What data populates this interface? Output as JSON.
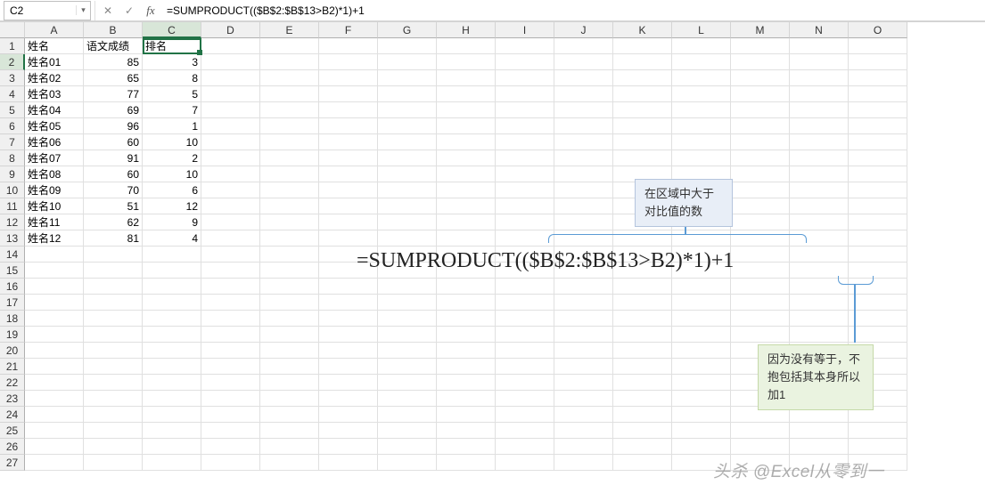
{
  "nameBox": {
    "value": "C2"
  },
  "formulaBar": {
    "formula": "=SUMPRODUCT(($B$2:$B$13>B2)*1)+1"
  },
  "icons": {
    "cancel": "✕",
    "confirm": "✓",
    "fx": "fx",
    "dropdown": "▾"
  },
  "columns": [
    "A",
    "B",
    "C",
    "D",
    "E",
    "F",
    "G",
    "H",
    "I",
    "J",
    "K",
    "L",
    "M",
    "N",
    "O"
  ],
  "rowCount": 27,
  "activeCol": 2,
  "activeRow": 1,
  "headers": {
    "A": "姓名",
    "B": "语文成绩",
    "C": "排名"
  },
  "rows": [
    {
      "name": "姓名01",
      "score": 85,
      "rank": 3
    },
    {
      "name": "姓名02",
      "score": 65,
      "rank": 8
    },
    {
      "name": "姓名03",
      "score": 77,
      "rank": 5
    },
    {
      "name": "姓名04",
      "score": 69,
      "rank": 7
    },
    {
      "name": "姓名05",
      "score": 96,
      "rank": 1
    },
    {
      "name": "姓名06",
      "score": 60,
      "rank": 10
    },
    {
      "name": "姓名07",
      "score": 91,
      "rank": 2
    },
    {
      "name": "姓名08",
      "score": 60,
      "rank": 10
    },
    {
      "name": "姓名09",
      "score": 70,
      "rank": 6
    },
    {
      "name": "姓名10",
      "score": 51,
      "rank": 12
    },
    {
      "name": "姓名11",
      "score": 62,
      "rank": 9
    },
    {
      "name": "姓名12",
      "score": 81,
      "rank": 4
    }
  ],
  "bigFormula": "=SUMPRODUCT(($B$2:$B$13>B2)*1)+1",
  "callout1": {
    "line1": "在区域中大于",
    "line2": "对比值的数"
  },
  "callout2": {
    "line1": "因为没有等于，不",
    "line2": "抱包括其本身所以",
    "line3": "加1"
  },
  "watermark": "头杀 @Excel从零到一"
}
